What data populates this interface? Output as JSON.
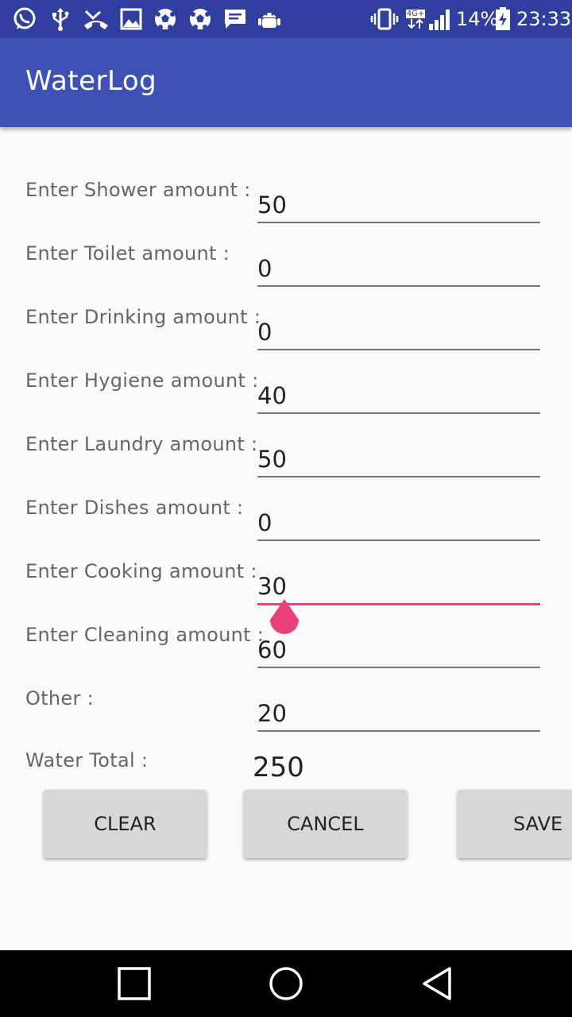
{
  "status_bar": {
    "battery_text": "14%",
    "time": "23:33",
    "network_label": "4G+",
    "icons": [
      "whatsapp-icon",
      "usb-icon",
      "missed-call-icon",
      "image-icon",
      "soccer-ball-icon",
      "soccer-ball-icon",
      "message-icon",
      "android-icon",
      "vibrate-icon",
      "network-icon",
      "signal-icon",
      "battery-icon"
    ]
  },
  "app_bar": {
    "title": "WaterLog"
  },
  "form": {
    "rows": [
      {
        "label": "Enter Shower amount :",
        "value": "50"
      },
      {
        "label": "Enter Toilet amount :",
        "value": "0"
      },
      {
        "label": "Enter Drinking amount :",
        "value": "0"
      },
      {
        "label": "Enter Hygiene amount :",
        "value": "40"
      },
      {
        "label": "Enter Laundry amount :",
        "value": "50"
      },
      {
        "label": "Enter Dishes amount :",
        "value": "0"
      },
      {
        "label": "Enter Cooking amount :",
        "value": "30"
      },
      {
        "label": "Enter Cleaning amount :",
        "value": "60"
      },
      {
        "label": "Other :",
        "value": "20"
      }
    ],
    "focused_field": "Enter Cooking amount :",
    "total_label": "Water Total :",
    "total_value": "250"
  },
  "buttons": {
    "clear": "CLEAR",
    "cancel": "CANCEL",
    "save": "SAVE"
  },
  "colors": {
    "status_bar": "#303f9f",
    "app_bar": "#3f51b5",
    "accent": "#ec407a",
    "background": "#fafafa",
    "button": "#d6d7d7"
  },
  "nav_bar": {
    "icons": [
      "recent-apps-icon",
      "home-icon",
      "back-icon"
    ]
  }
}
